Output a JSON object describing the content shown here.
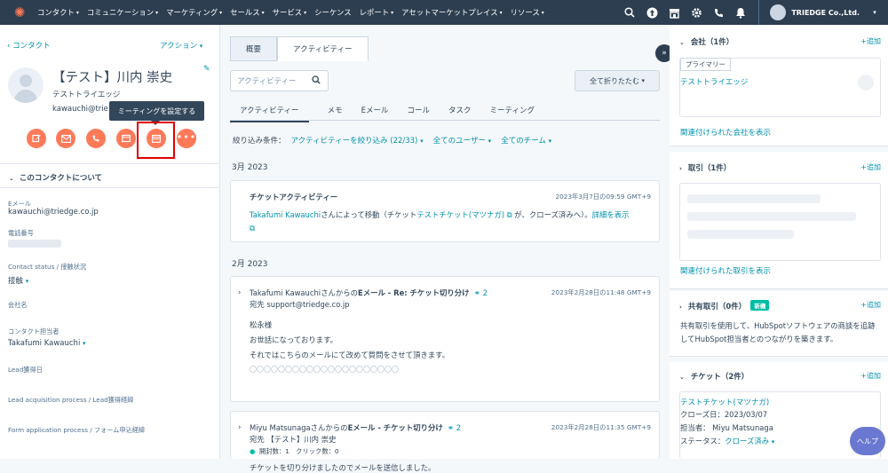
{
  "nav": {
    "items": [
      "コンタクト",
      "コミュニケーション",
      "マーケティング",
      "セールス",
      "サービス",
      "シーケンス",
      "レポート",
      "アセットマーケットプレイス",
      "リソース"
    ],
    "company": "TRIEDGE Co.,Ltd."
  },
  "contact": {
    "back": "コンタクト",
    "action": "アクション",
    "name": "【テスト】川内 崇史",
    "company": "テストトライエッジ",
    "email_short": "kawauchi@trie",
    "tooltip": "ミーティングを設定する",
    "section_title": "このコンタクトについて",
    "props": [
      {
        "label": "Eメール",
        "value": "kawauchi@triedge.co.jp"
      },
      {
        "label": "電話番号",
        "value": ""
      },
      {
        "label": "Contact status / 接触状況",
        "value": "接触"
      },
      {
        "label": "会社名",
        "value": ""
      },
      {
        "label": "コンタクト担当者",
        "value": "Takafumi Kawauchi"
      },
      {
        "label": "Lead獲得日",
        "value": ""
      },
      {
        "label": "Lead acquisition process / Lead獲得経緯",
        "value": ""
      },
      {
        "label": "Form application process / フォーム申込経緯",
        "value": ""
      }
    ]
  },
  "center": {
    "tabs": [
      "概要",
      "アクティビティー"
    ],
    "search_placeholder": "アクティビティー",
    "collapse_all": "全て折りたたむ",
    "subtabs": [
      "アクティビティー",
      "メモ",
      "Eメール",
      "コール",
      "タスク",
      "ミーティング"
    ],
    "filter_label": "絞り込み条件：",
    "filter_activity": "アクティビティーを絞り込み (22/33)",
    "filter_users": "全てのユーザー",
    "filter_teams": "全てのチーム",
    "month1": "3月 2023",
    "card1": {
      "title": "チケットアクティビティー",
      "time": "2023年3月7日の09:59 GMT+9",
      "user": "Takafumi Kawauchi",
      "text1": "さんによって移動（チケット",
      "ticket": "テストチケット(マツナガ)",
      "text2": "が、クローズ済みへ）。",
      "detail": "詳細を表示"
    },
    "month2": "2月 2023",
    "card2": {
      "title_prefix": "Takafumi Kawauchiさんからの",
      "title_bold": "Eメール - Re: チケット切り分け",
      "count": "2",
      "time": "2023年2月28日の11:48 GMT+9",
      "to": "宛先 support@triedge.co.jp",
      "line1": "松永様",
      "line2": "お世話になっております。",
      "line3": "それではこちらのメールにて改めて質問をさせて頂きます。",
      "line4": "〇〇〇〇〇〇〇〇〇〇〇〇〇〇〇〇〇〇〇〇〇"
    },
    "card3": {
      "title_prefix": "Miyu Matsunagaさんからの",
      "title_bold": "Eメール - チケット切り分け",
      "count": "2",
      "time": "2023年2月28日の11:35 GMT+9",
      "to": "宛先 【テスト】川内 崇史",
      "opens": "開封数：1　クリック数：0",
      "body": "チケットを切り分けましたのでメールを送信しました。"
    }
  },
  "right": {
    "company": {
      "title": "会社（1件）",
      "add": "+追加",
      "badge": "プライマリー",
      "name": "テストトライエッジ",
      "link": "関連付けられた会社を表示"
    },
    "deals": {
      "title": "取引（1件）",
      "add": "+追加",
      "link": "関連付けられた取引を表示"
    },
    "shared": {
      "title": "共有取引（0件）",
      "badge": "新機",
      "add": "+追加",
      "text1": "共有取引を使用して、HubSpotソフトウェアの商談を追跡",
      "text2": "してHubSpot担当者とのつながりを築きます。"
    },
    "tickets": {
      "title": "チケット（2件）",
      "add": "+追加",
      "name": "テストチケット(マツナガ)",
      "close": "クローズ日：2023/03/07",
      "owner": "担当者：  Miyu Matsunaga",
      "status_label": "ステータス：",
      "status": "クローズ済み"
    }
  },
  "help": "ヘルプ"
}
